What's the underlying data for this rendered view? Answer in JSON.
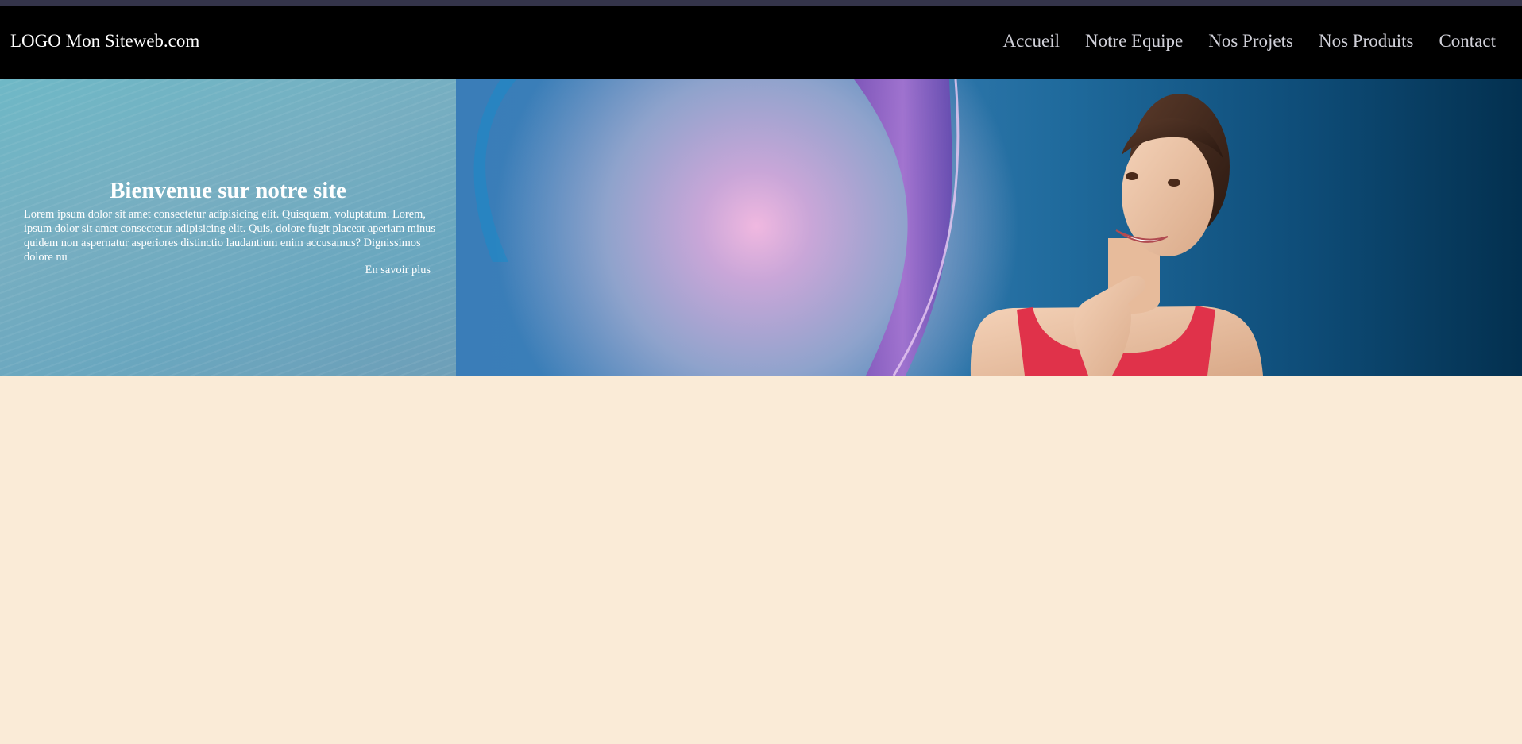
{
  "header": {
    "logo": "LOGO Mon Siteweb.com",
    "nav": {
      "home": "Accueil",
      "team": "Notre Equipe",
      "projects": "Nos Projets",
      "products": "Nos Produits",
      "contact": "Contact"
    }
  },
  "hero": {
    "title": "Bienvenue sur notre site",
    "text": "Lorem ipsum dolor sit amet consectetur adipisicing elit. Quisquam, voluptatum. Lorem, ipsum dolor sit amet consectetur adipisicing elit. Quis, dolore fugit placeat aperiam minus quidem non aspernatur asperiores distinctio laudantium enim accusamus? Dignissimos dolore nu",
    "cta": "En savoir plus"
  },
  "colors": {
    "page_background": "#FAEBD7",
    "header_background": "#000000",
    "nav_text": "#d0d0d8"
  }
}
